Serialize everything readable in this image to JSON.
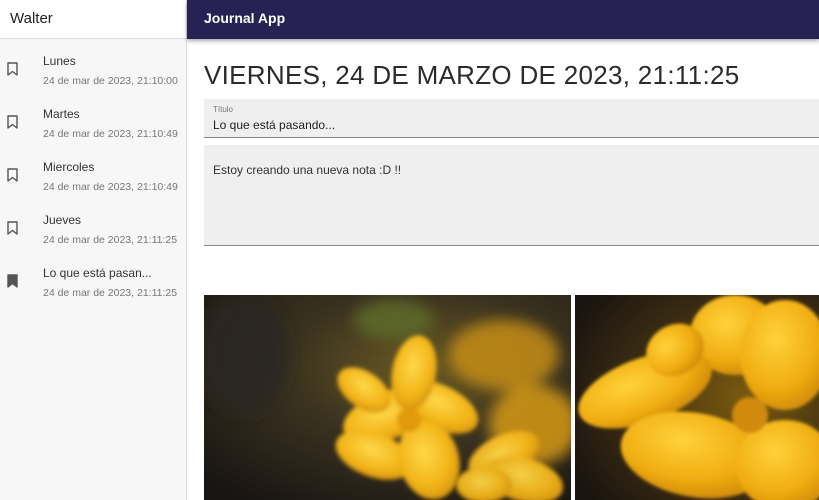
{
  "sidebar": {
    "user_name": "Walter",
    "entries": [
      {
        "title": "Lunes",
        "date": "24 de mar de 2023, 21:10:00",
        "active": false
      },
      {
        "title": "Martes",
        "date": "24 de mar de 2023, 21:10:49",
        "active": false
      },
      {
        "title": "Miercoles",
        "date": "24 de mar de 2023, 21:10:49",
        "active": false
      },
      {
        "title": "Jueves",
        "date": "24 de mar de 2023, 21:11:25",
        "active": false
      },
      {
        "title": "Lo que está pasan...",
        "date": "24 de mar de 2023, 21:11:25",
        "active": true
      }
    ]
  },
  "appbar": {
    "title": "Journal App"
  },
  "note": {
    "date_heading": "VIERNES, 24 DE MARZO DE 2023, 21:11:25",
    "title_label": "Título",
    "title_value": "Lo que está pasando...",
    "body_value": "Estoy creando una nueva nota :D !!"
  },
  "icons": {
    "bookmark_outline": "bookmark-border-icon",
    "bookmark_filled": "bookmark-icon"
  },
  "colors": {
    "appbar": "#262254",
    "sidebar_bg": "#f7f7f7",
    "field_bg": "#efefef",
    "flower": "#f2b21a"
  }
}
